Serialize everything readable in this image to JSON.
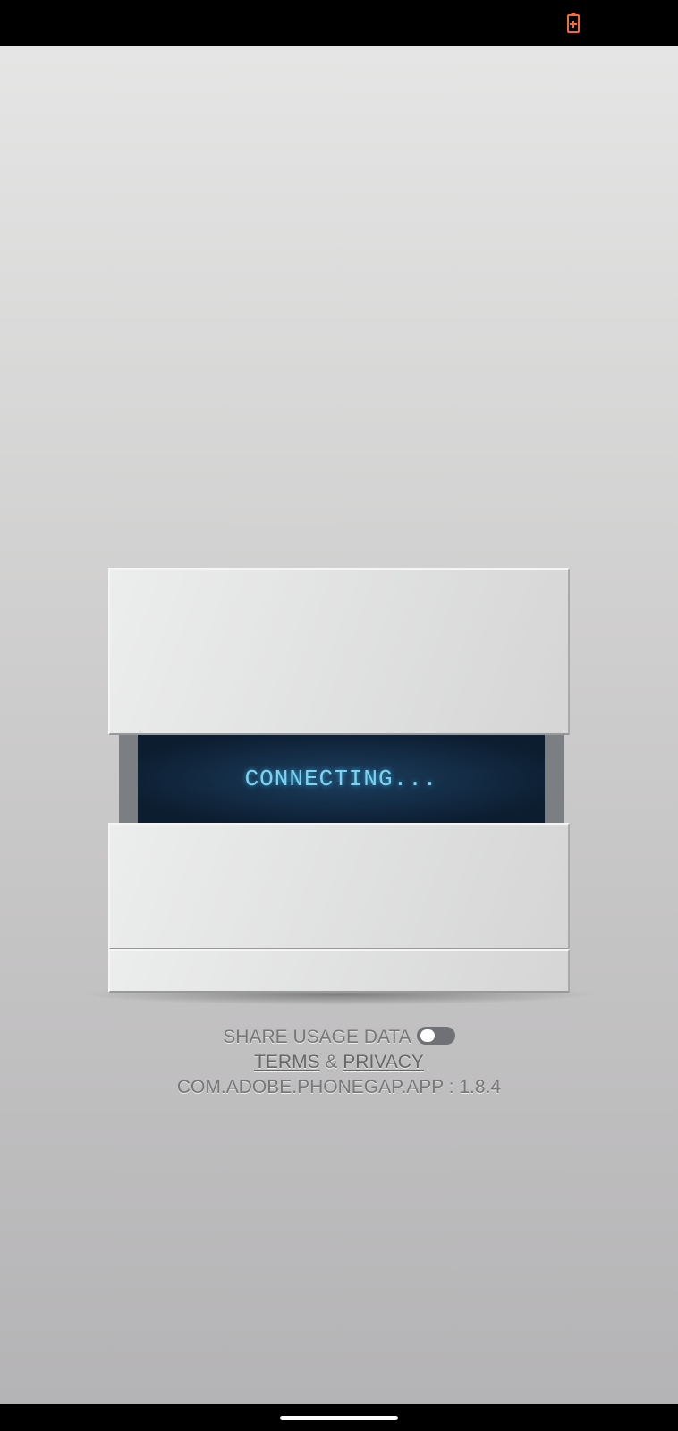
{
  "status_bar": {
    "battery_icon": "battery-charging-icon",
    "battery_color": "#f26b3a"
  },
  "device": {
    "screen_text": "CONNECTING..."
  },
  "footer": {
    "share_label": "SHARE USAGE DATA",
    "share_enabled": false,
    "terms": "TERMS",
    "amp": "&",
    "privacy": "PRIVACY",
    "version": "COM.ADOBE.PHONEGAP.APP : 1.8.4"
  }
}
